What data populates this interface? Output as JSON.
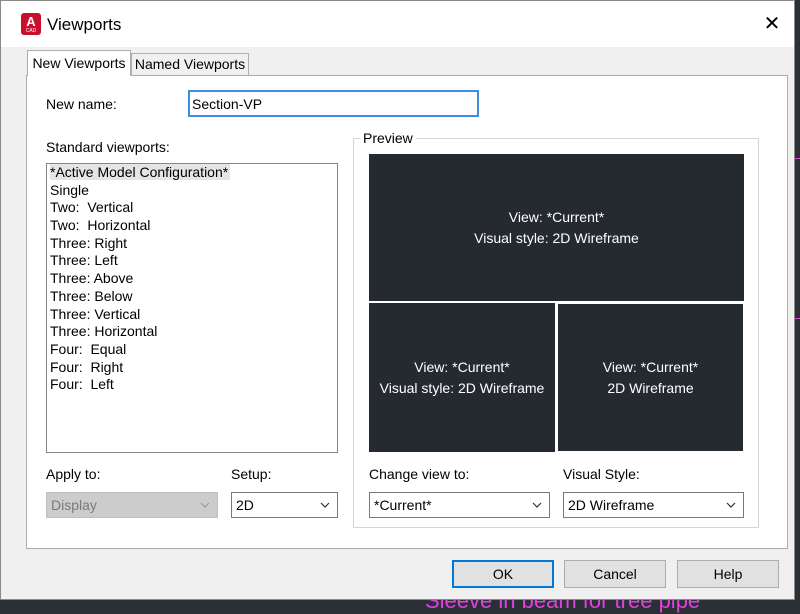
{
  "window": {
    "title": "Viewports",
    "app_icon_letter": "A",
    "app_icon_sub": "CAD",
    "close_glyph": "✕"
  },
  "tabs": [
    {
      "label": "New Viewports",
      "active": true
    },
    {
      "label": "Named Viewports",
      "active": false
    }
  ],
  "new_name": {
    "label": "New name:",
    "value": "Section-VP"
  },
  "standard_viewports": {
    "label": "Standard viewports:",
    "selected_index": 0,
    "items": [
      "*Active Model Configuration*",
      "Single",
      "Two:  Vertical",
      "Two:  Horizontal",
      "Three: Right",
      "Three: Left",
      "Three: Above",
      "Three: Below",
      "Three: Vertical",
      "Three: Horizontal",
      "Four:  Equal",
      "Four:  Right",
      "Four:  Left"
    ]
  },
  "preview": {
    "label": "Preview",
    "viewports": [
      {
        "line1": "View: *Current*",
        "line2": "Visual style: 2D Wireframe"
      },
      {
        "line1": "View: *Current*",
        "line2": "Visual style: 2D Wireframe"
      },
      {
        "line1": "View: *Current*",
        "line2": "2D Wireframe"
      }
    ]
  },
  "apply_to": {
    "label": "Apply to:",
    "value": "Display",
    "enabled": false
  },
  "setup": {
    "label": "Setup:",
    "value": "2D"
  },
  "change_view_to": {
    "label": "Change view to:",
    "value": "*Current*"
  },
  "visual_style": {
    "label": "Visual Style:",
    "value": "2D Wireframe"
  },
  "buttons": {
    "ok": "OK",
    "cancel": "Cancel",
    "help": "Help"
  },
  "background": {
    "command_text": "Sleeve in beam for tree pipe"
  },
  "colors": {
    "accent": "#0078d7",
    "preview_bg": "#252a30",
    "app_icon": "#c8102e",
    "background_cad": "#2b2f36"
  }
}
